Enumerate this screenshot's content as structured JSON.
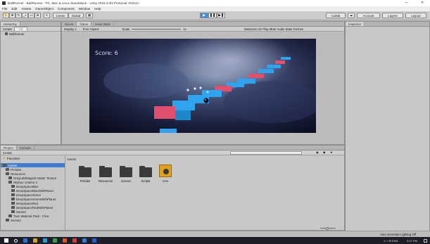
{
  "window": {
    "title": "BallRunner - BallRunner - PC, Mac & Linux Standalone - Unity 2018.3.0f2 Personal <DX11>",
    "minimize": "—",
    "close": "✕"
  },
  "menu": [
    "File",
    "Edit",
    "Assets",
    "GameObject",
    "Component",
    "Window",
    "Help"
  ],
  "toolbar": {
    "pivot": "Center",
    "space": "Global",
    "collab": "Collab",
    "account": "Account",
    "layers": "Layers",
    "layout": "Layout"
  },
  "hierarchy": {
    "tab": "Hierarchy",
    "create": "Create",
    "search_placeholder": "All",
    "scene_name": "BallRunner"
  },
  "center_tabs": [
    "Scene",
    "Game",
    "Asset Store"
  ],
  "game_bar": {
    "display": "Display 1",
    "aspect": "Free Aspect",
    "scale_label": "Scale",
    "scale_value": "1x",
    "options": "Maximize On Play   Mute Audio   Stats   Gizmos"
  },
  "game": {
    "score": "Score: 6"
  },
  "inspector": {
    "tab": "Inspector"
  },
  "project": {
    "tabs": [
      "Project",
      "Console"
    ],
    "create": "Create",
    "favorites": "Favorites",
    "tree": [
      {
        "label": "Assets",
        "indent": 0,
        "selected": true
      },
      {
        "label": "Prefabs",
        "indent": 1
      },
      {
        "label": "Resources",
        "indent": 1
      },
      {
        "label": "GrayLab/MagicD Water Texture",
        "indent": 2
      },
      {
        "label": "Skybox Volume 2",
        "indent": 2
      },
      {
        "label": "DeepSpaceBlue",
        "indent": 3
      },
      {
        "label": "DeepSpaceBlueWithPlanet",
        "indent": 3
      },
      {
        "label": "DeepSpaceGreen",
        "indent": 3
      },
      {
        "label": "DeepSpaceGreenWithPlanet",
        "indent": 3
      },
      {
        "label": "DeepSpaceRed",
        "indent": 3
      },
      {
        "label": "DeepSpaceRedWithPlanet",
        "indent": 3
      },
      {
        "label": "Sunset",
        "indent": 3
      },
      {
        "label": "Toon Material Pack - Free",
        "indent": 2
      },
      {
        "label": "Scenes",
        "indent": 1
      }
    ],
    "breadcrumb": "Assets",
    "assets": [
      {
        "label": "Prefabs",
        "type": "folder"
      },
      {
        "label": "Resources",
        "type": "folder"
      },
      {
        "label": "Scenes",
        "type": "folder"
      },
      {
        "label": "Scripts",
        "type": "folder"
      },
      {
        "label": "Icon",
        "type": "image"
      }
    ]
  },
  "status": {
    "lighting": "Auto Generate Lighting Off"
  },
  "taskbar": {
    "tray": "∧ ⌂ ✉ ENG",
    "time": "3:27 PM",
    "icon_colors": [
      "#2a6fd6",
      "#d6a12a",
      "#2a9bd6",
      "#3aa04a",
      "#d65a2a",
      "#d63a3a",
      "#3a7ad6",
      "#2a5ad6"
    ]
  }
}
